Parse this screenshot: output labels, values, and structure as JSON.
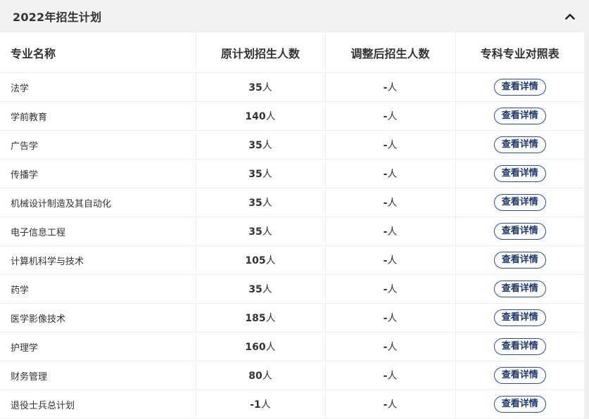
{
  "panel": {
    "title": "2022年招生计划",
    "collapse_icon": "chevron-up-icon"
  },
  "table": {
    "headers": [
      "专业名称",
      "原计划招生人数",
      "调整后招生人数",
      "专科专业对照表"
    ],
    "unit": "人",
    "button_label": "查看详情",
    "rows": [
      {
        "name": "法学",
        "plan": "35",
        "adjusted": "-"
      },
      {
        "name": "学前教育",
        "plan": "140",
        "adjusted": "-"
      },
      {
        "name": "广告学",
        "plan": "35",
        "adjusted": "-"
      },
      {
        "name": "传播学",
        "plan": "35",
        "adjusted": "-"
      },
      {
        "name": "机械设计制造及其自动化",
        "plan": "35",
        "adjusted": "-"
      },
      {
        "name": "电子信息工程",
        "plan": "35",
        "adjusted": "-"
      },
      {
        "name": "计算机科学与技术",
        "plan": "105",
        "adjusted": "-"
      },
      {
        "name": "药学",
        "plan": "35",
        "adjusted": "-"
      },
      {
        "name": "医学影像技术",
        "plan": "185",
        "adjusted": "-"
      },
      {
        "name": "护理学",
        "plan": "160",
        "adjusted": "-"
      },
      {
        "name": "财务管理",
        "plan": "80",
        "adjusted": "-"
      },
      {
        "name": "退役士兵总计划",
        "plan": "-1",
        "adjusted": "-"
      }
    ]
  },
  "colors": {
    "accent": "#2a4f8f",
    "header_bg": "#f2f2f2"
  }
}
